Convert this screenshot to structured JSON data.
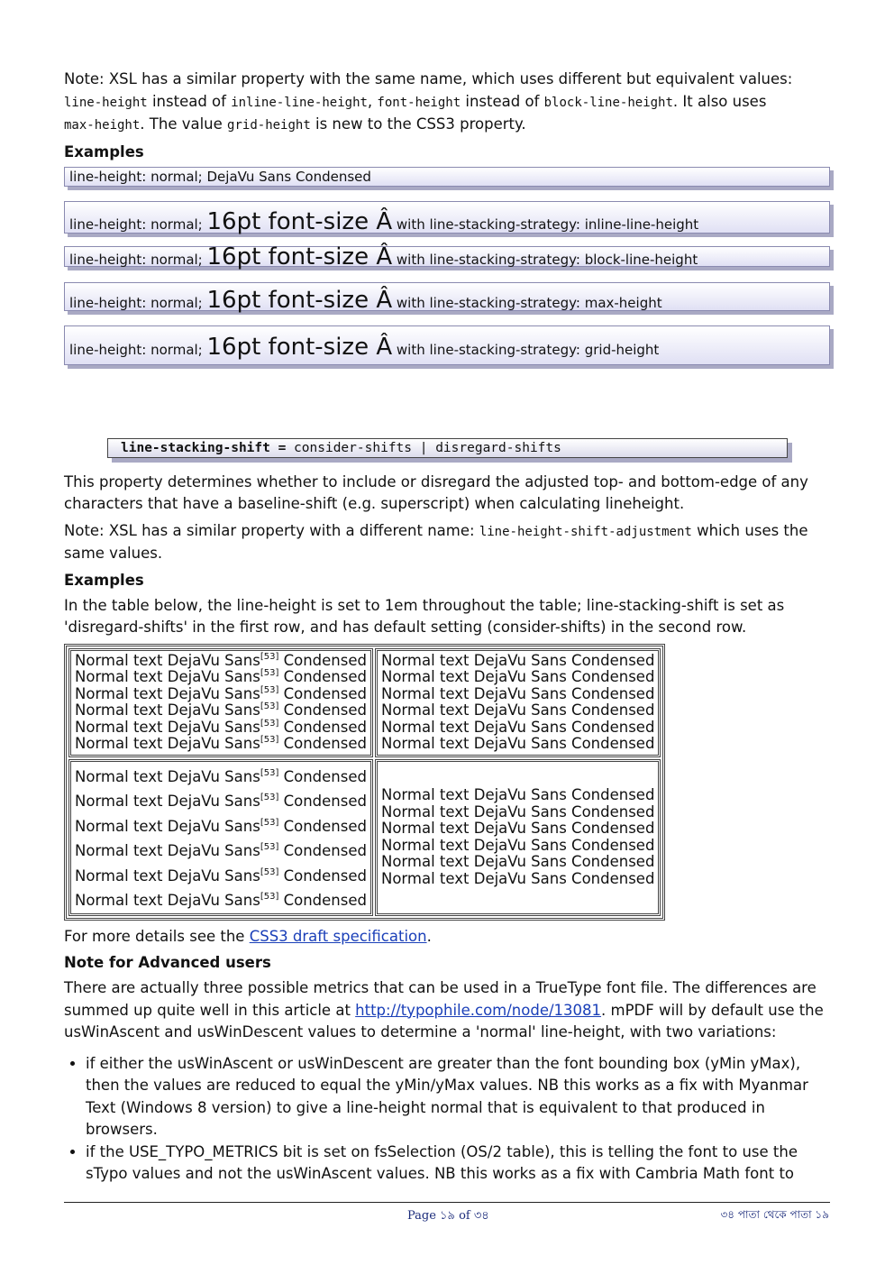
{
  "note1": {
    "t1": "Note: XSL has a similar property with the same name, which uses different but equivalent values:",
    "c1": "line-height",
    "t2": " instead of ",
    "c2": "inline-line-height",
    "t3": ", ",
    "c3": "font-height",
    "t4": " instead of ",
    "c4": "block-line-height",
    "t5": ". It also uses ",
    "c5": "max-height",
    "t6": ". The value ",
    "c6": "grid-height",
    "t7": " is new to the CSS3 property."
  },
  "examples_heading_1": "Examples",
  "example_boxes": [
    {
      "pre": "line-height: normal; DejaVu Sans Condensed",
      "big": "",
      "post": ""
    },
    {
      "pre": "line-height: normal; ",
      "big": "16pt font-size Â",
      "post": " with line-stacking-strategy: inline-line-height"
    },
    {
      "pre": "line-height: normal; ",
      "big": "16pt font-size Â",
      "post": " with line-stacking-strategy: block-line-height"
    },
    {
      "pre": "line-height: normal; ",
      "big": "16pt font-size Â",
      "post": " with line-stacking-strategy: max-height"
    },
    {
      "pre": "line-height: normal; ",
      "big": "16pt font-size Â",
      "post": " with line-stacking-strategy: grid-height"
    }
  ],
  "syntax": {
    "property": "line-stacking-shift =",
    "values": " consider-shifts | disregard-shifts"
  },
  "description": "This property determines whether to include or disregard the adjusted top- and bottom-edge of any characters that have a baseline-shift (e.g. superscript) when calculating lineheight.",
  "note2": {
    "t1": "Note: XSL has a similar property with a different name: ",
    "c1": "line-height-shift-adjustment",
    "t2": " which uses the same values."
  },
  "examples_heading_2": "Examples",
  "table_intro": "In the table below, the line-height is set to 1em throughout the table; line-stacking-shift is set as 'disregard-shifts' in the first row, and has default setting (consider-shifts) in the second row.",
  "table": {
    "sup_line": {
      "before": "Normal text DejaVu Sans",
      "sup": "[53]",
      "after": " Condensed"
    },
    "plain_line": "Normal text DejaVu Sans Condensed"
  },
  "more_details": {
    "before": "For more details see the ",
    "link": "CSS3 draft specification",
    "after": "."
  },
  "advanced_heading": "Note for Advanced users",
  "advanced_para": {
    "before": "There are actually three possible metrics that can be used in a TrueType font file. The differences are summed up quite well in this article at ",
    "link": "http://typophile.com/node/13081",
    "after": ". mPDF will by default use the usWinAscent and usWinDescent values to determine a 'normal' line-height, with two variations:"
  },
  "bullets": [
    "if either the usWinAscent or usWinDescent are greater than the font bounding box (yMin yMax), then the values are reduced to equal the yMin/yMax values. NB this works as a fix with Myanmar Text (Windows 8 version) to give a line-height normal that is equivalent to that produced in browsers.",
    "if the USE_TYPO_METRICS bit is set on fsSelection (OS/2 table), this is telling the font to use the sTypo values and not the usWinAscent values. NB this works as a fix with Cambria Math font to"
  ],
  "footer": {
    "center": "Page ১৯ of ৩৪",
    "right": "৩৪ পাতা থেকে পাতা ১৯"
  }
}
